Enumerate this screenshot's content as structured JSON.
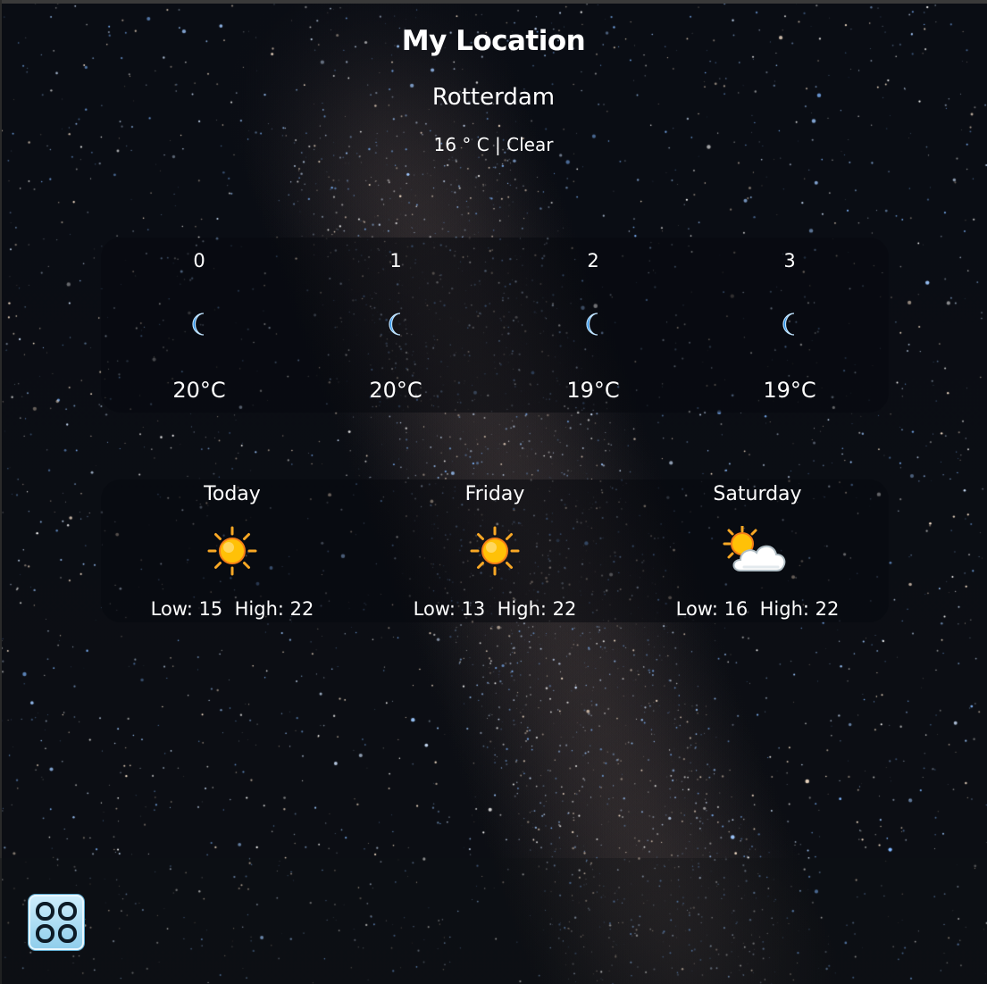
{
  "header": {
    "title": "My Location",
    "city": "Rotterdam",
    "current": "16 ° C | Clear"
  },
  "hourly": [
    {
      "hour": "0",
      "icon": "moon-icon",
      "temp": "20°C"
    },
    {
      "hour": "1",
      "icon": "moon-icon",
      "temp": "20°C"
    },
    {
      "hour": "2",
      "icon": "moon-icon",
      "temp": "19°C"
    },
    {
      "hour": "3",
      "icon": "moon-icon",
      "temp": "19°C"
    }
  ],
  "daily": [
    {
      "day": "Today",
      "icon": "sun-icon",
      "range": "Low: 15  High: 22"
    },
    {
      "day": "Friday",
      "icon": "sun-icon",
      "range": "Low: 13  High: 22"
    },
    {
      "day": "Saturday",
      "icon": "sun-behind-cloud-icon",
      "range": "Low: 16  High: 22"
    }
  ],
  "dock": {
    "apps_icon": "app-grid-icon"
  },
  "colors": {
    "background": "#0b0e14",
    "moon": "#1e88e5",
    "sun": "#ffc107",
    "apps_button": "#9fd6f0"
  }
}
